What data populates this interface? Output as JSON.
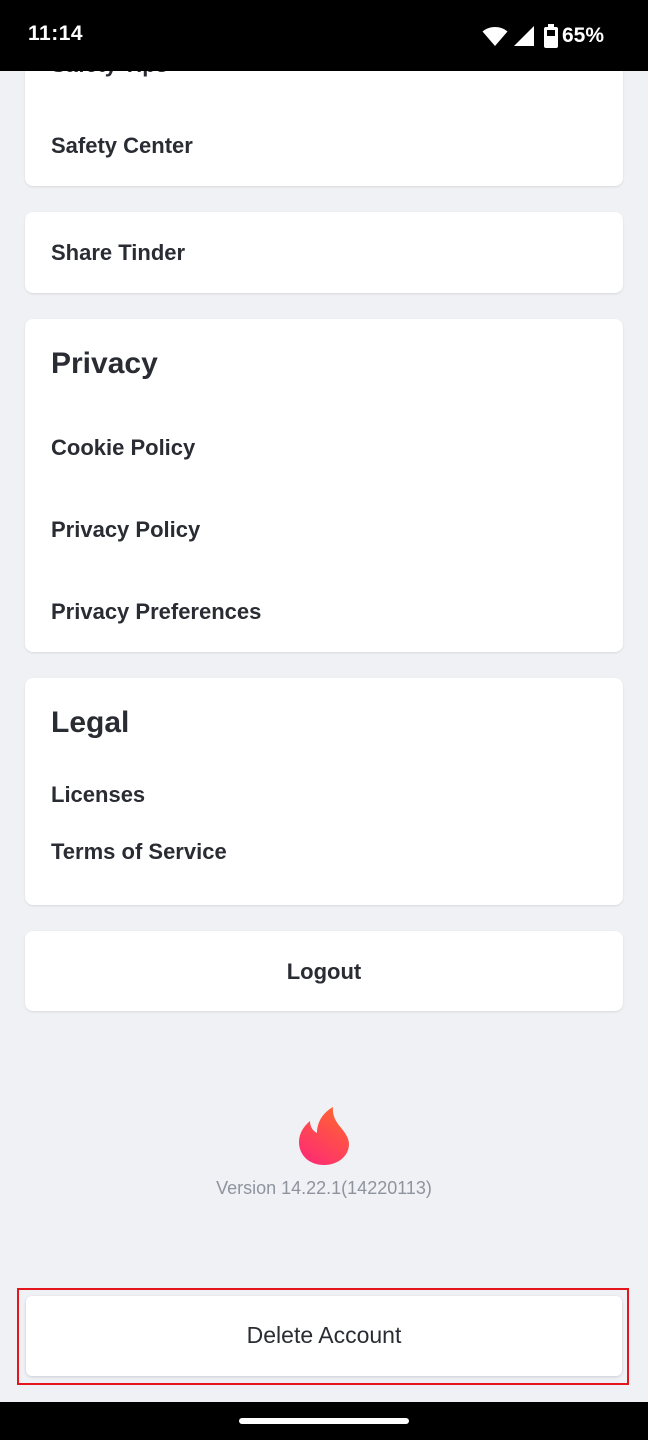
{
  "status_bar": {
    "time": "11:14",
    "battery": "65%",
    "icons": [
      "wifi-icon",
      "cell-signal-icon",
      "battery-icon"
    ]
  },
  "safety": {
    "items": [
      {
        "label": "Safety Tips"
      },
      {
        "label": "Safety Center"
      }
    ]
  },
  "share": {
    "label": "Share Tinder"
  },
  "privacy": {
    "title": "Privacy",
    "items": [
      {
        "label": "Cookie Policy"
      },
      {
        "label": "Privacy Policy"
      },
      {
        "label": "Privacy Preferences"
      }
    ]
  },
  "legal": {
    "title": "Legal",
    "items": [
      {
        "label": "Licenses"
      },
      {
        "label": "Terms of Service"
      }
    ]
  },
  "logout": {
    "label": "Logout"
  },
  "footer": {
    "logo_icon": "tinder-flame-icon",
    "version": "Version 14.22.1(14220113)"
  },
  "delete_account": {
    "label": "Delete Account"
  },
  "colors": {
    "brand_gradient_start": "#fd267a",
    "brand_gradient_end": "#ff6036",
    "highlight": "#e3161e",
    "background": "#f0f1f5"
  }
}
